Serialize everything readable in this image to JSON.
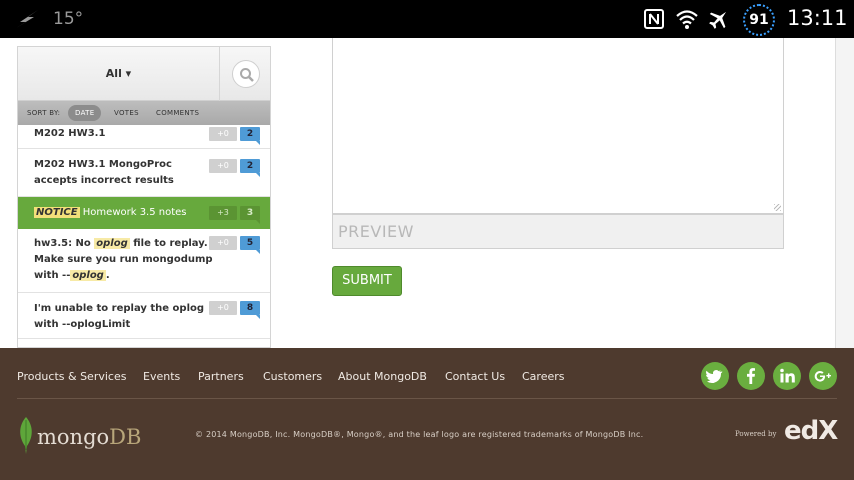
{
  "status_bar": {
    "temperature": "15°",
    "battery": "91",
    "time": "13:11",
    "icons": [
      "weather-icon",
      "nfc-icon",
      "wifi-icon",
      "airplane-mode-icon"
    ]
  },
  "sidebar": {
    "filter_label": "All ▾",
    "sort_by_label": "SORT BY:",
    "sort_options": [
      "DATE",
      "VOTES",
      "COMMENTS"
    ],
    "active_sort": "DATE",
    "threads": [
      {
        "title": "M202 HW3.1",
        "votes": "+0",
        "comments": "2"
      },
      {
        "title_line1": "M202 HW3.1 MongoProc",
        "title_line2": "accepts incorrect results",
        "votes": "+0",
        "comments": "2"
      },
      {
        "tag": "NOTICE",
        "title": "Homework 3.5 notes",
        "votes": "+3",
        "comments": "3"
      },
      {
        "pre": "hw3.5: No",
        "hl1": "oplog",
        "post": "file to replay.",
        "line2": "Make sure you run mongodump",
        "line3_pre": "with --",
        "hl2": "oplog",
        "line3_post": ".",
        "votes": "+0",
        "comments": "5"
      },
      {
        "title_line1": "I'm unable to replay the oplog",
        "title_line2": "with --oplogLimit",
        "votes": "+0",
        "comments": "8"
      }
    ]
  },
  "editor": {
    "preview_label": "PREVIEW",
    "submit_label": "SUBMIT"
  },
  "footer": {
    "nav": [
      "Products & Services",
      "Events",
      "Partners",
      "Customers",
      "About MongoDB",
      "Contact Us",
      "Careers"
    ],
    "social": [
      "twitter-icon",
      "facebook-icon",
      "linkedin-icon",
      "google-plus-icon"
    ],
    "logo_text_1": "mongo",
    "logo_text_2": "DB",
    "copyright": "© 2014 MongoDB, Inc. MongoDB®, Mongo®, and the leaf logo are registered trademarks of MongoDB Inc.",
    "powered_by": "Powered by",
    "powered_brand": "edX",
    "colors": {
      "background": "#4e3a2e",
      "social": "#6aae3f",
      "accent_green": "#67a93d"
    }
  }
}
